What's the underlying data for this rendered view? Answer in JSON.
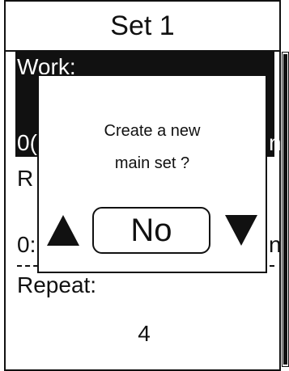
{
  "header": {
    "title": "Set 1"
  },
  "work": {
    "label": "Work:",
    "value_fragment": "0(",
    "unit_fragment": "n"
  },
  "rest": {
    "label_fragment": "R",
    "value_fragment": "0:",
    "unit_fragment": "n"
  },
  "repeat": {
    "label": "Repeat:",
    "value": "4"
  },
  "dialog": {
    "line1": "Create a new",
    "line2": "main set ?",
    "selected_option": "No",
    "up_icon": "triangle-up-icon",
    "down_icon": "triangle-down-icon"
  },
  "colors": {
    "foreground": "#111111",
    "background": "#ffffff"
  }
}
